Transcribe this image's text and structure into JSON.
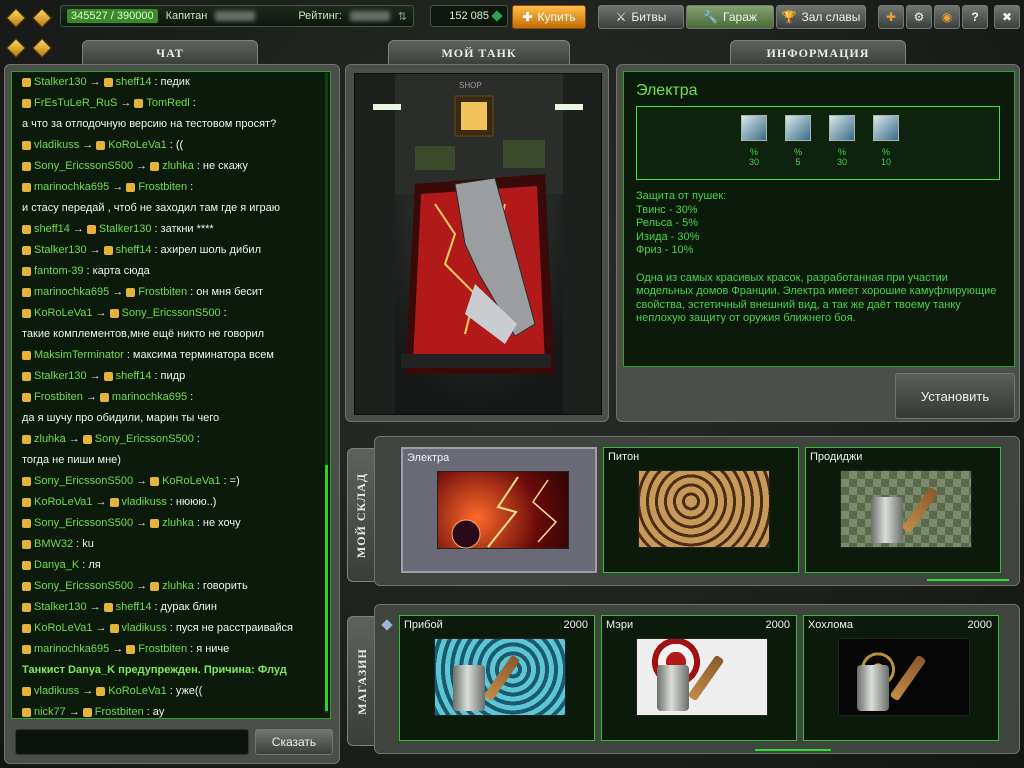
{
  "topbar": {
    "xp": "345527 / 390000",
    "rank": "Капитан",
    "rating_label": "Рейтинг:",
    "crystals": "152 085",
    "buy": "Купить",
    "battles": "Битвы",
    "garage": "Гараж",
    "hall": "Зал славы",
    "help": "?"
  },
  "tabs": {
    "chat": "ЧАТ",
    "tank": "МОЙ ТАНК",
    "info": "ИНФОРМАЦИЯ"
  },
  "chat": {
    "lines": [
      {
        "from": "Stalker130",
        "to": "sheff14",
        "text": "педик"
      },
      {
        "from": "FrEsTuLeR_RuS",
        "to": "TomRedl",
        "text": ""
      },
      {
        "from": "",
        "to": "",
        "text": "а что за отлодочную версию на тестовом просят?"
      },
      {
        "from": "vladikuss",
        "to": "KoRoLeVa1",
        "text": "(("
      },
      {
        "from": "Sony_EricssonS500",
        "to": "zluhka",
        "text": "не скажу"
      },
      {
        "from": "marinochka695",
        "to": "Frostbiten",
        "text": ""
      },
      {
        "from": "",
        "to": "",
        "text": "и стасу передай , чтоб не заходил там где я играю"
      },
      {
        "from": "sheff14",
        "to": "Stalker130",
        "text": "заткни ****"
      },
      {
        "from": "Stalker130",
        "to": "sheff14",
        "text": "ахирел шоль дибил"
      },
      {
        "from": "fantom-39",
        "to": "",
        "text": "карта сюда"
      },
      {
        "from": "marinochka695",
        "to": "Frostbiten",
        "text": "он мня бесит"
      },
      {
        "from": "KoRoLeVa1",
        "to": "Sony_EricssonS500",
        "text": ""
      },
      {
        "from": "",
        "to": "",
        "text": "такие комплементов,мне ещё никто не говорил"
      },
      {
        "from": "MaksimTerminator",
        "to": "",
        "text": "максима терминатора всем"
      },
      {
        "from": "Stalker130",
        "to": "sheff14",
        "text": "пидр"
      },
      {
        "from": "Frostbiten",
        "to": "marinochka695",
        "text": ""
      },
      {
        "from": "",
        "to": "",
        "text": "да я шучу про обидили, марин ты чего"
      },
      {
        "from": "zluhka",
        "to": "Sony_EricssonS500",
        "text": ""
      },
      {
        "from": "",
        "to": "",
        "text": "тогда не пиши мне)"
      },
      {
        "from": "Sony_EricssonS500",
        "to": "KoRoLeVa1",
        "text": "=)"
      },
      {
        "from": "KoRoLeVa1",
        "to": "vladikuss",
        "text": "нююю..)"
      },
      {
        "from": "Sony_EricssonS500",
        "to": "zluhka",
        "text": "не хочу"
      },
      {
        "from": "BMW32",
        "to": "",
        "text": "ku"
      },
      {
        "from": "Danya_K",
        "to": "",
        "text": "ля"
      },
      {
        "from": "Sony_EricssonS500",
        "to": "zluhka",
        "text": "говорить"
      },
      {
        "from": "Stalker130",
        "to": "sheff14",
        "text": "дурак блин"
      },
      {
        "from": "KoRoLeVa1",
        "to": "vladikuss",
        "text": "пуся не расстраивайся"
      },
      {
        "from": "marinochka695",
        "to": "Frostbiten",
        "text": "я ниче"
      },
      {
        "from": "",
        "to": "",
        "warn": "Танкист Danya_K предупрежден. Причина: Флуд"
      },
      {
        "from": "vladikuss",
        "to": "KoRoLeVa1",
        "text": "уже(("
      },
      {
        "from": "nick77",
        "to": "Frostbiten",
        "text": "ay"
      }
    ],
    "say": "Сказать"
  },
  "info": {
    "title": "Электра",
    "protections": [
      {
        "icon": "twins-icon",
        "pct": "%",
        "val": "30"
      },
      {
        "icon": "railgun-icon",
        "pct": "%",
        "val": "5"
      },
      {
        "icon": "isida-icon",
        "pct": "%",
        "val": "30"
      },
      {
        "icon": "freeze-icon",
        "pct": "%",
        "val": "10"
      }
    ],
    "prot_header": "Защита от пушек:",
    "prot_lines": [
      "Твинс - 30%",
      "Рельса - 5%",
      "Изида - 30%",
      "Фриз - 10%"
    ],
    "description": "Одна из самых красивых красок, разработанная при участии модельных домов Франции. Электра имеет хорошие камуфлирующие свойства, эстетичный внешний вид, а так же даёт твоему танку неплохую защиту от оружия ближнего боя.",
    "install": "Установить"
  },
  "tank_view": {
    "sign": "SHOP"
  },
  "warehouse": {
    "label": "МОЙ СКЛАД",
    "items": [
      {
        "name": "Электра",
        "selected": true
      },
      {
        "name": "Питон"
      },
      {
        "name": "Продиджи"
      }
    ]
  },
  "shop": {
    "label": "МАГАЗИН",
    "items": [
      {
        "name": "Прибой",
        "price": "2000"
      },
      {
        "name": "Мэри",
        "price": "2000"
      },
      {
        "name": "Хохлома",
        "price": "2000"
      }
    ]
  },
  "colors": {
    "accent": "#2ee02e",
    "text_green": "#4ad24a",
    "title_green": "#6de24a"
  }
}
